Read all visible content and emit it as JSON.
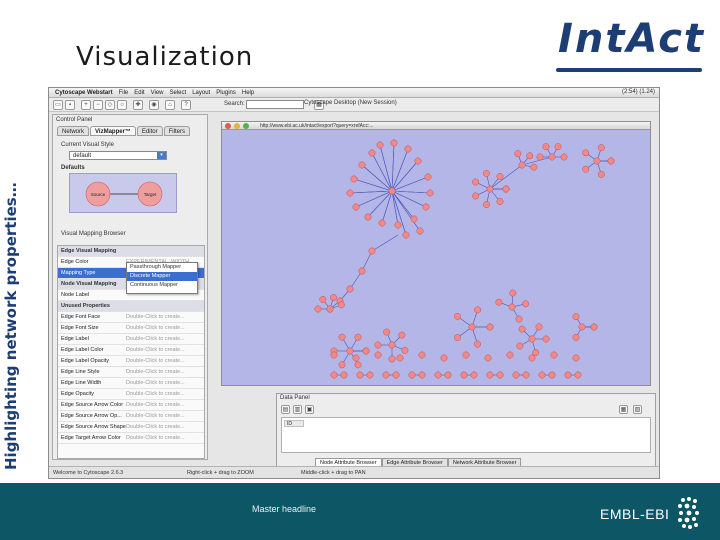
{
  "slide": {
    "side_title": "Highlighting network properties…",
    "title": "Visualization",
    "logo_text": "IntAct",
    "footer_headline": "Master headline",
    "footer_logo_text": "EMBL-EBI",
    "colors": {
      "title_blue": "#1d3e75",
      "footer_teal": "#0c5665"
    }
  },
  "app": {
    "menubar": {
      "app_name": "Cytoscape Webstart",
      "menus": [
        "File",
        "Edit",
        "View",
        "Select",
        "Layout",
        "Plugins",
        "Help"
      ],
      "right_status": "(2:54) (1.24)"
    },
    "window_title": "Cytoscape Desktop (New Session)",
    "search_label": "Search:",
    "control_panel": {
      "title": "Control Panel",
      "tabs": [
        "Network",
        "VizMapper™",
        "Editor",
        "Filters"
      ],
      "active_tab": "VizMapper™",
      "current_visual_style_label": "Current Visual Style",
      "visual_style_value": "default",
      "defaults_label": "Defaults",
      "default_node_source": "Source",
      "default_node_target": "Target",
      "mapping_browser_label": "Visual Mapping Browser",
      "sections": [
        {
          "label": "Edge Visual Mapping",
          "section": true
        },
        {
          "label": "Edge Color",
          "value": "EXPERIMENTAL_WIDTH",
          "section": false
        },
        {
          "label": "Mapping Type",
          "value": "",
          "section": false,
          "highlight": true
        },
        {
          "label": "Node Visual Mapping",
          "section": true
        },
        {
          "label": "Node Label",
          "value": "",
          "section": false
        },
        {
          "label": "Unused Properties",
          "section": true
        },
        {
          "label": "Edge Font Face",
          "value": "Double-Click to create...",
          "section": false
        },
        {
          "label": "Edge Font Size",
          "value": "Double-Click to create...",
          "section": false
        },
        {
          "label": "Edge Label",
          "value": "Double-Click to create...",
          "section": false
        },
        {
          "label": "Edge Label Color",
          "value": "Double-Click to create...",
          "section": false
        },
        {
          "label": "Edge Label Opacity",
          "value": "Double-Click to create...",
          "section": false
        },
        {
          "label": "Edge Line Style",
          "value": "Double-Click to create...",
          "section": false
        },
        {
          "label": "Edge Line Width",
          "value": "Double-Click to create...",
          "section": false
        },
        {
          "label": "Edge Opacity",
          "value": "Double-Click to create...",
          "section": false
        },
        {
          "label": "Edge Source Arrow Color",
          "value": "Double-Click to create...",
          "section": false
        },
        {
          "label": "Edge Source Arrow Op...",
          "value": "Double-Click to create...",
          "section": false
        },
        {
          "label": "Edge Source Arrow Shape",
          "value": "Double-Click to create...",
          "section": false
        },
        {
          "label": "Edge Target Arrow Color",
          "value": "Double-Click to create...",
          "section": false
        }
      ],
      "mapping_popup": [
        "Passthrough Mapper",
        "Discrete Mapper",
        "Continuous Mapper"
      ],
      "mapping_popup_selected": "Discrete Mapper"
    },
    "network_view": {
      "url": "http://www.ebi.ac.uk/intact/export?query=xrefAcc:..."
    },
    "data_panel": {
      "title": "Data Panel",
      "column_header": "ID",
      "tabs": [
        "Node Attribute Browser",
        "Edge Attribute Browser",
        "Network Attribute Browser"
      ],
      "active_tab": "Node Attribute Browser"
    },
    "statusbar": {
      "left": "Welcome to Cytoscape 2.6.3",
      "middle": "Right-click + drag to ZOOM",
      "right": "Middle-click + drag to PAN"
    }
  }
}
